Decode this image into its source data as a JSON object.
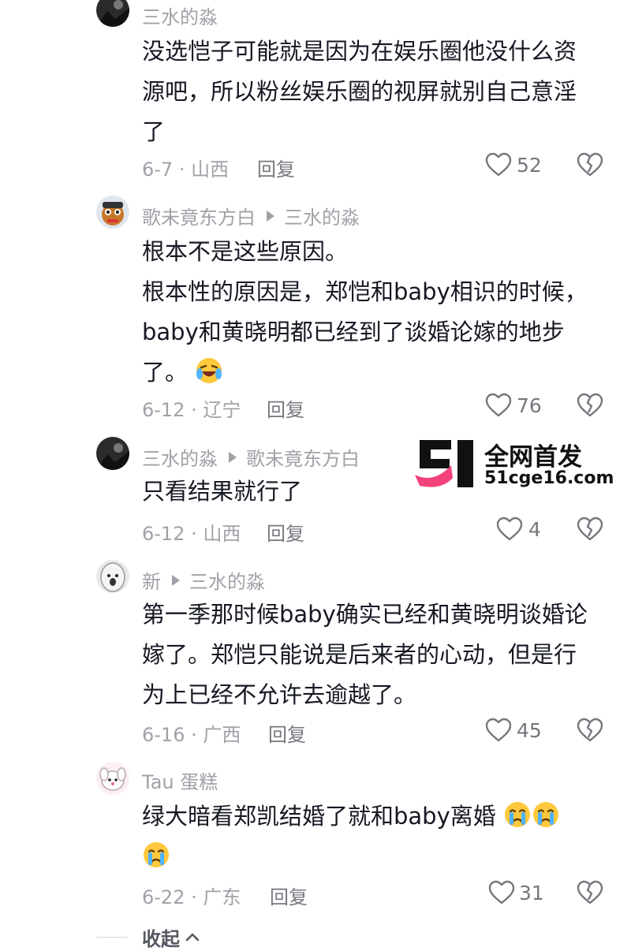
{
  "comments": [
    {
      "author": "三水的淼",
      "reply_to": "",
      "lines": [
        "没选恺子可能就是因为在娱乐圈他没什么资",
        "源吧，所以粉丝娱乐圈的视屏就别自己意淫",
        "了"
      ],
      "date_location": "6-7 · 山西",
      "reply_label": "回复",
      "likes": "52"
    },
    {
      "author": "歌未竟东方白",
      "reply_to": "三水的淼",
      "lines": [
        "根本不是这些原因。",
        "根本性的原因是，郑恺和baby相识的时候，",
        "baby和黄晓明都已经到了谈婚论嫁的地步",
        "了。"
      ],
      "date_location": "6-12 · 辽宁",
      "reply_label": "回复",
      "likes": "76"
    },
    {
      "author": "三水的淼",
      "reply_to": "歌未竟东方白",
      "lines": [
        "只看结果就行了"
      ],
      "date_location": "6-12 · 山西",
      "reply_label": "回复",
      "likes": "4"
    },
    {
      "author": "新",
      "reply_to": "三水的淼",
      "lines": [
        "第一季那时候baby确实已经和黄晓明谈婚论",
        "嫁了。郑恺只能说是后来者的心动，但是行",
        "为上已经不允许去逾越了。"
      ],
      "date_location": "6-16 · 广西",
      "reply_label": "回复",
      "likes": "45"
    },
    {
      "author": "Tau 蛋糕",
      "reply_to": "",
      "lines": [
        "绿大暗看郑凯结婚了就和baby离婚",
        ""
      ],
      "date_location": "6-22 · 广东",
      "reply_label": "回复",
      "likes": "31"
    }
  ],
  "watermark": {
    "title": "全网首发",
    "site": "51cge16.com"
  },
  "collapse_label": "收起",
  "icons": [
    "heart-outline-icon",
    "broken-heart-icon",
    "play-arrow-icon",
    "laughing-crying-emoji",
    "crying-emoji",
    "chevron-up-icon"
  ],
  "colors": {
    "text": "#161823",
    "muted": "#a0a2a8",
    "watermark_pink": "#f2437a"
  }
}
